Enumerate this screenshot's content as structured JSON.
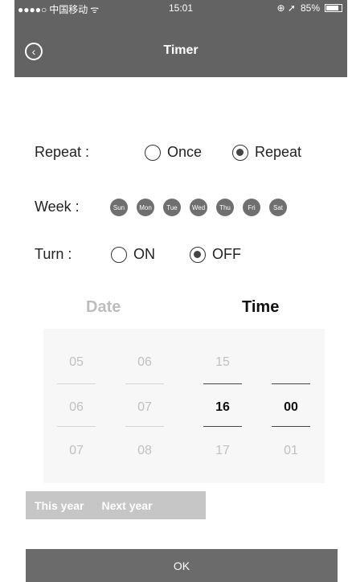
{
  "status_bar": {
    "signal": "●●●●○",
    "carrier": "中国移动",
    "wifi": "ᯤ",
    "time": "15:01",
    "battery_text": "85%",
    "battery_level": 0.85
  },
  "header": {
    "title": "Timer",
    "back_icon": "chevron-left-circle"
  },
  "repeat": {
    "label": "Repeat :",
    "options": [
      {
        "label": "Once",
        "checked": false
      },
      {
        "label": "Repeat",
        "checked": true
      }
    ]
  },
  "week": {
    "label": "Week :",
    "days": [
      "Sun",
      "Mon",
      "Tue",
      "Wed",
      "Thu",
      "Fri",
      "Sat"
    ]
  },
  "turn": {
    "label": "Turn :",
    "options": [
      {
        "label": "ON",
        "checked": false
      },
      {
        "label": "OFF",
        "checked": true
      }
    ]
  },
  "sections": {
    "date": "Date",
    "time": "Time"
  },
  "picker": {
    "month": [
      "05",
      "06",
      "07"
    ],
    "day": [
      "06",
      "07",
      "08"
    ],
    "hour": [
      "15",
      "16",
      "17"
    ],
    "minute": [
      "",
      "00",
      "01"
    ]
  },
  "year_buttons": [
    "This year",
    "Next year"
  ],
  "ok_label": "OK",
  "colors": {
    "header": "#636363",
    "ok": "#6b6b6b",
    "year_bar": "#c6c6c6"
  }
}
